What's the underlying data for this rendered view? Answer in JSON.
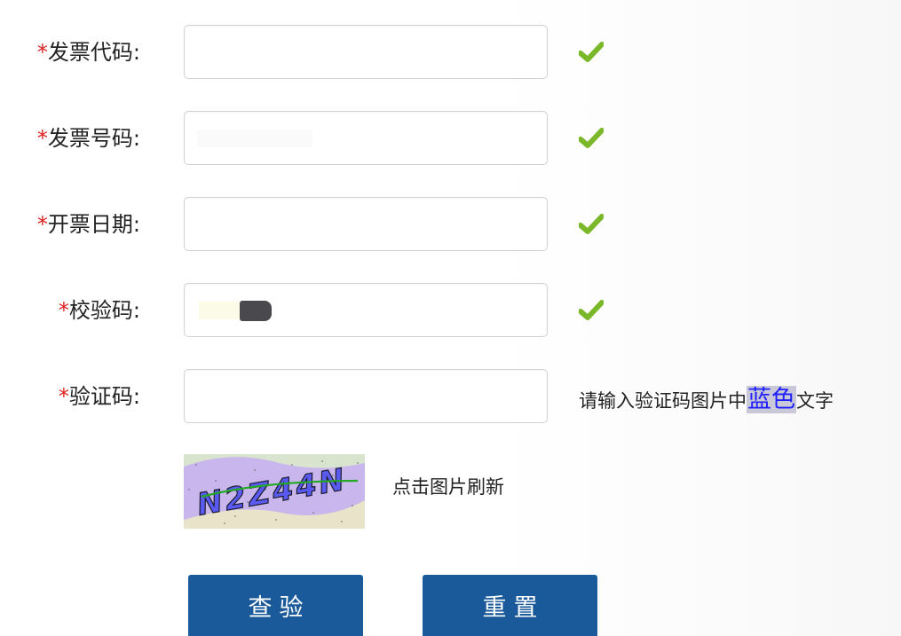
{
  "form": {
    "required_mark": "*",
    "fields": [
      {
        "label": "发票代码:",
        "value": "",
        "valid": true
      },
      {
        "label": "发票号码:",
        "value": "",
        "valid": true
      },
      {
        "label": "开票日期:",
        "value": "",
        "valid": true
      },
      {
        "label": "校验码:",
        "value": "",
        "valid": true
      },
      {
        "label": "验证码:",
        "value": "",
        "valid": false
      }
    ],
    "captcha_hint": {
      "before": "请输入验证码图片中",
      "highlight": "蓝色",
      "after": "文字"
    },
    "captcha_text": "N2Z44N",
    "refresh_label": "点击图片刷新",
    "check_button": "查验",
    "reset_button": "重置"
  },
  "colors": {
    "required": "#e02020",
    "check_icon": "#7ab829",
    "button": "#1a5a9a",
    "highlight_text": "#2020ff"
  },
  "icons": {
    "valid": "check-icon"
  }
}
